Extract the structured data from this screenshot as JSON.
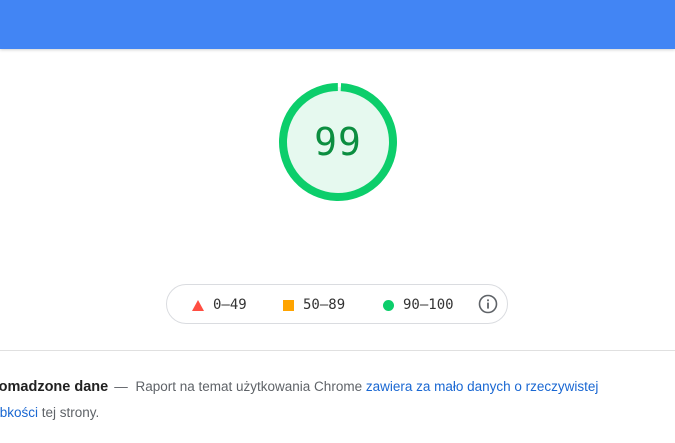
{
  "header": {
    "color": "#4285f4"
  },
  "score": {
    "value": "99",
    "fraction": 0.99,
    "ring_color": "#0cce6b",
    "fill_color": "#e6f9ef",
    "text_color": "#0c8e40"
  },
  "legend": {
    "items": [
      {
        "shape": "triangle",
        "color": "#ff4e42",
        "label": "0–49"
      },
      {
        "shape": "square",
        "color": "#ffa400",
        "label": "50–89"
      },
      {
        "shape": "circle",
        "color": "#0cce6b",
        "label": "90–100"
      }
    ],
    "info_icon": "info-icon"
  },
  "field_data": {
    "title": "romadzone dane",
    "dash": "—",
    "text_before": " Raport na temat użytkowania Chrome ",
    "link_1": "zawiera za mało danych o rzeczywistej",
    "link_2": "ybkości",
    "text_after": " tej strony."
  }
}
